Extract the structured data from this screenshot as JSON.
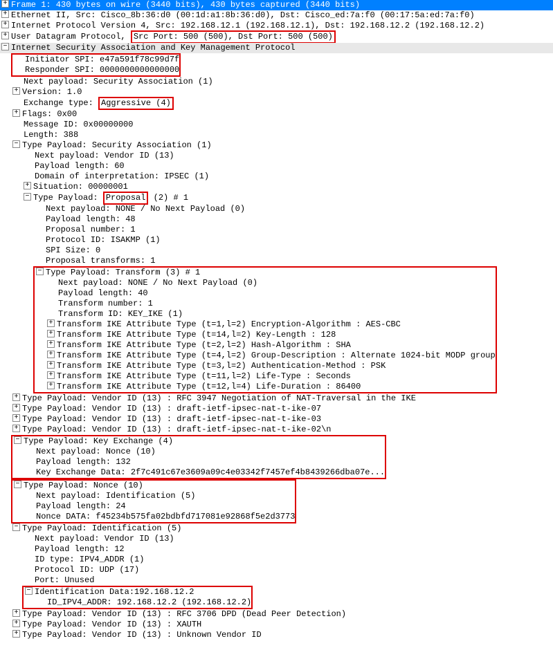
{
  "frame": {
    "title": "Frame 1: 430 bytes on wire (3440 bits), 430 bytes captured (3440 bits)"
  },
  "ethernet": "Ethernet II, Src: Cisco_8b:36:d0 (00:1d:a1:8b:36:d0), Dst: Cisco_ed:7a:f0 (00:17:5a:ed:7a:f0)",
  "ip": "Internet Protocol Version 4, Src: 192.168.12.1 (192.168.12.1), Dst: 192.168.12.2 (192.168.12.2)",
  "udp_prefix": "User Datagram Protocol, ",
  "udp_ports": "Src Port: 500 (500), Dst Port: 500 (500)",
  "isakmp": {
    "title": "Internet Security Association and Key Management Protocol",
    "init_spi": "Initiator SPI: e47a591f78c99d7f",
    "resp_spi": "Responder SPI: 0000000000000000",
    "next_payload": "Next payload: Security Association (1)",
    "version": "Version: 1.0",
    "exchange_label": "Exchange type: ",
    "exchange_value": "Aggressive (4)",
    "flags": "Flags: 0x00",
    "msgid": "Message ID: 0x00000000",
    "length": "Length: 388"
  },
  "sa": {
    "title": "Type Payload: Security Association (1)",
    "next": "Next payload: Vendor ID (13)",
    "paylen": "Payload length: 60",
    "doi": "Domain of interpretation: IPSEC (1)",
    "situation": "Situation: 00000001",
    "proposal_prefix": "Type Payload: ",
    "proposal_word": "Proposal",
    "proposal_suffix": " (2) # 1",
    "prop_next": "Next payload: NONE / No Next Payload  (0)",
    "prop_len": "Payload length: 48",
    "prop_num": "Proposal number: 1",
    "prop_proto": "Protocol ID: ISAKMP (1)",
    "prop_spi": "SPI Size: 0",
    "prop_trans": "Proposal transforms: 1"
  },
  "transform": {
    "title": "Type Payload: Transform (3) # 1",
    "next": "Next payload: NONE / No Next Payload  (0)",
    "len": "Payload length: 40",
    "num": "Transform number: 1",
    "id": "Transform ID: KEY_IKE (1)",
    "attr1": "Transform IKE Attribute Type (t=1,l=2) Encryption-Algorithm : AES-CBC",
    "attr2": "Transform IKE Attribute Type (t=14,l=2) Key-Length : 128",
    "attr3": "Transform IKE Attribute Type (t=2,l=2) Hash-Algorithm : SHA",
    "attr4": "Transform IKE Attribute Type (t=4,l=2) Group-Description : Alternate 1024-bit MODP group",
    "attr5": "Transform IKE Attribute Type (t=3,l=2) Authentication-Method : PSK",
    "attr6": "Transform IKE Attribute Type (t=11,l=2) Life-Type : Seconds",
    "attr7": "Transform IKE Attribute Type (t=12,l=4) Life-Duration : 86400"
  },
  "vid1": "Type Payload: Vendor ID (13) : RFC 3947 Negotiation of NAT-Traversal in the IKE",
  "vid2": "Type Payload: Vendor ID (13) : draft-ietf-ipsec-nat-t-ike-07",
  "vid3": "Type Payload: Vendor ID (13) : draft-ietf-ipsec-nat-t-ike-03",
  "vid4": "Type Payload: Vendor ID (13) : draft-ietf-ipsec-nat-t-ike-02\\n",
  "ke": {
    "title": "Type Payload: Key Exchange (4)",
    "next": "Next payload: Nonce (10)",
    "len": "Payload length: 132",
    "data": "Key Exchange Data: 2f7c491c67e3609a09c4e03342f7457ef4b8439266dba07e..."
  },
  "nonce": {
    "title": "Type Payload: Nonce (10)",
    "next": "Next payload: Identification (5)",
    "len": "Payload length: 24",
    "data": "Nonce DATA: f45234b575fa02bdbfd717081e92868f5e2d3773"
  },
  "id": {
    "title": "Type Payload: Identification (5)",
    "next": "Next payload: Vendor ID (13)",
    "len": "Payload length: 12",
    "idtype": "ID type: IPV4_ADDR (1)",
    "proto": "Protocol ID: UDP (17)",
    "port": "Port: Unused",
    "iddata": "Identification Data:192.168.12.2",
    "idaddr": "ID_IPV4_ADDR: 192.168.12.2 (192.168.12.2)"
  },
  "vid5": "Type Payload: Vendor ID (13) : RFC 3706 DPD (Dead Peer Detection)",
  "vid6": "Type Payload: Vendor ID (13) : XAUTH",
  "vid7": "Type Payload: Vendor ID (13) : Unknown Vendor ID"
}
